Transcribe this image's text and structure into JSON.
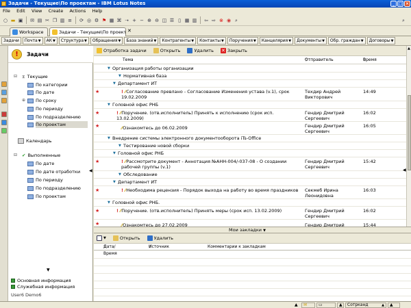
{
  "window": {
    "title": "Задачи - Текущие\\По проектам - IBM Lotus Notes"
  },
  "menu": [
    "File",
    "Edit",
    "View",
    "Create",
    "Actions",
    "Help"
  ],
  "tabs": [
    {
      "label": "Workspace",
      "active": false
    },
    {
      "label": "Задачи - Текущие\\По проекта...",
      "active": true
    }
  ],
  "bookmarks": [
    "Задачи",
    "Почта",
    "АК",
    "Структура",
    "Обращения",
    "База знаний",
    "Контрагенты",
    "Контакты",
    "Поручения",
    "Канцелярия",
    "Документы",
    "Обр. граждан",
    "Договоры"
  ],
  "nav": {
    "title": "Задачи",
    "current": {
      "label": "Текущие",
      "items": [
        "По категории",
        "По дате",
        "По сроку",
        "По периоду",
        "По подразделению",
        "По проектам"
      ]
    },
    "calendar": "Календарь",
    "done": {
      "label": "Выполненные",
      "items": [
        "По дате",
        "По дате отработки",
        "По периоду",
        "По подразделению",
        "По проектам"
      ]
    },
    "footer": [
      "Основная информация",
      "Служебная информация"
    ],
    "user": "User6 Demo6"
  },
  "actions": [
    "Отработка задачи",
    "Открыть",
    "Удалить",
    "Закрыть"
  ],
  "columns": {
    "subject": "Тема",
    "sender": "Отправитель",
    "time": "Время"
  },
  "rows": [
    {
      "type": "cat",
      "level": 0,
      "text": "Организация работы организации"
    },
    {
      "type": "cat",
      "level": 1,
      "text": "Нормативная база"
    },
    {
      "type": "cat",
      "level": 1,
      "text": "Департамент ИТ"
    },
    {
      "type": "doc",
      "star": true,
      "exc": true,
      "text": "Согласование превлано - Согласование Изменения устава (v.1), срок 19.02.2009",
      "sender": "Техдир Андрей Викторович",
      "time": "14:49"
    },
    {
      "type": "cat",
      "level": 1,
      "text": "Головной офис РНБ"
    },
    {
      "type": "doc",
      "star": true,
      "exc": true,
      "text": "Поручение. (отв.исполнитель)  Принять к исполнению  (срок исп. 13.02.2009)",
      "sender": "Гендир Дмитрий Сергеевич",
      "time": "16:02"
    },
    {
      "type": "doc",
      "star": true,
      "exc": false,
      "text": "Ознакомтесь до 06.02.2009",
      "sender": "Гендир Дмитрий Сергеевич",
      "time": "16:05"
    },
    {
      "type": "cat",
      "level": 0,
      "text": "Внедрение системы электронного документооборота iTs-Office"
    },
    {
      "type": "cat",
      "level": 1,
      "text": "Тестирование новой сборки"
    },
    {
      "type": "cat",
      "level": 1,
      "text": "Головной офис РНБ"
    },
    {
      "type": "doc",
      "star": true,
      "exc": true,
      "text": "Рассмотрите документ - Аннотация №АНН-004/-037-08 - О создании рабочей группы (v.1)",
      "sender": "Гендир Дмитрий Сергеевич",
      "time": "15:42"
    },
    {
      "type": "cat",
      "level": 1,
      "text": "Обследование"
    },
    {
      "type": "cat",
      "level": 1,
      "text": "Департамент ИТ"
    },
    {
      "type": "doc",
      "star": true,
      "exc": true,
      "text": "Необходима рецензия - Порядок выхода на работу во время праздников",
      "sender": "Секмеб Ирина Леонидовна",
      "time": "16:03"
    },
    {
      "type": "cat",
      "level": 1,
      "text": "Головной офис РНБ."
    },
    {
      "type": "doc",
      "star": true,
      "exc": true,
      "text": "Поручение. (отв.исполнитель)  Принять меры  (срок исп. 13.02.2009)",
      "sender": "Гендир Дмитрий Сергеевич",
      "time": "16:02"
    },
    {
      "type": "doc",
      "star": true,
      "exc": false,
      "text": "Ознакомтесь до 27.02.2009",
      "sender": "Гендир Дмитрий",
      "time": "15:44"
    }
  ],
  "splitter": "Мои закладки",
  "lower": {
    "actions": [
      "Открыть",
      "Удалить"
    ],
    "columns": [
      "Дата/Время",
      "Источник",
      "Комментарии к закладкам"
    ]
  },
  "status": {
    "location": "Сотрканд"
  }
}
